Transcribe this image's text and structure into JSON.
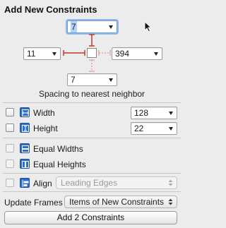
{
  "panel": {
    "title": "Add New Constraints",
    "spacing_caption": "Spacing to nearest neighbor"
  },
  "spacing": {
    "top": "7",
    "left": "11",
    "right": "394",
    "bottom": "7"
  },
  "size": {
    "width_label": "Width",
    "width_value": "128",
    "height_label": "Height",
    "height_value": "22"
  },
  "equal": {
    "widths_label": "Equal Widths",
    "heights_label": "Equal Heights"
  },
  "align": {
    "label": "Align",
    "value": "Leading Edges"
  },
  "update": {
    "label": "Update Frames",
    "value": "Items of New Constraints"
  },
  "add_button": "Add 2 Constraints",
  "colors": {
    "constraint_red": "#c0392b",
    "icon_blue": "#2d6fc8",
    "focus_ring": "#8fb8ec"
  }
}
